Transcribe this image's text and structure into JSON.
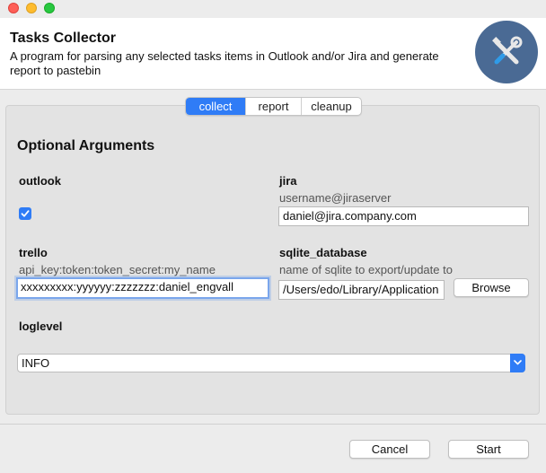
{
  "app": {
    "title": "Tasks Collector",
    "description": "A program for parsing any selected tasks items in Outlook and/or Jira and generate report to pastebin",
    "icon": "tools-icon",
    "accent": "#2f7cf6"
  },
  "tabs": [
    {
      "label": "collect",
      "active": true
    },
    {
      "label": "report",
      "active": false
    },
    {
      "label": "cleanup",
      "active": false
    }
  ],
  "section_title": "Optional Arguments",
  "outlook": {
    "label": "outlook",
    "checked": true
  },
  "jira": {
    "label": "jira",
    "hint": "username@jiraserver",
    "value": "daniel@jira.company.com"
  },
  "trello": {
    "label": "trello",
    "hint": "api_key:token:token_secret:my_name",
    "value": "xxxxxxxxx:yyyyyy:zzzzzzz:daniel_engvall"
  },
  "sqlite_database": {
    "label": "sqlite_database",
    "hint": "name of sqlite to export/update to",
    "value": "/Users/edo/Library/Application",
    "browse_label": "Browse"
  },
  "loglevel": {
    "label": "loglevel",
    "value": "INFO"
  },
  "footer": {
    "cancel_label": "Cancel",
    "start_label": "Start"
  }
}
